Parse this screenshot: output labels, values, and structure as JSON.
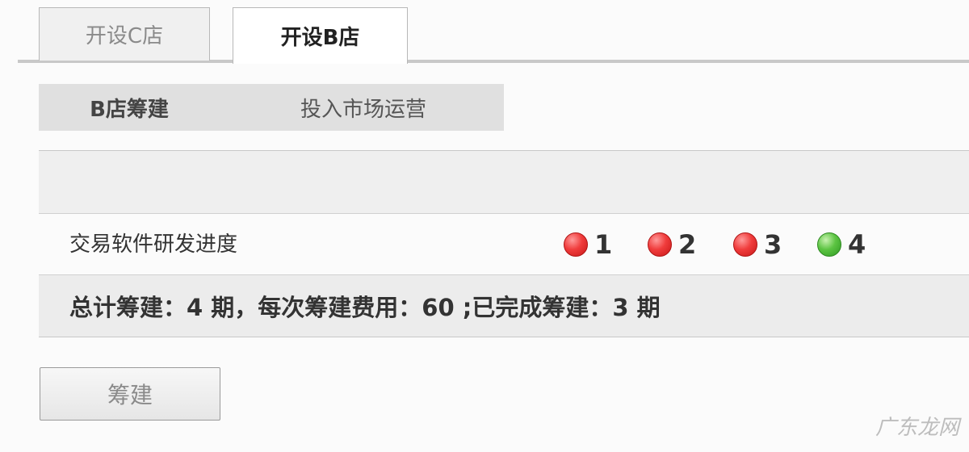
{
  "tabs": [
    {
      "label": "开设C店",
      "active": false
    },
    {
      "label": "开设B店",
      "active": true
    }
  ],
  "subtabs": [
    {
      "label": "B店筹建",
      "active": true
    },
    {
      "label": "投入市场运营",
      "active": false
    }
  ],
  "progress": {
    "label": "交易软件研发进度",
    "stages": [
      {
        "number": "1",
        "status": "red"
      },
      {
        "number": "2",
        "status": "red"
      },
      {
        "number": "3",
        "status": "red"
      },
      {
        "number": "4",
        "status": "green"
      }
    ]
  },
  "summary": {
    "text": "总计筹建：4 期，每次筹建费用：60 ;已完成筹建：3 期"
  },
  "actions": {
    "build_label": "筹建"
  },
  "watermark": "广东龙网",
  "colors": {
    "status_red": "#e83232",
    "status_green": "#4cb83a",
    "band_gray": "#ececec"
  }
}
